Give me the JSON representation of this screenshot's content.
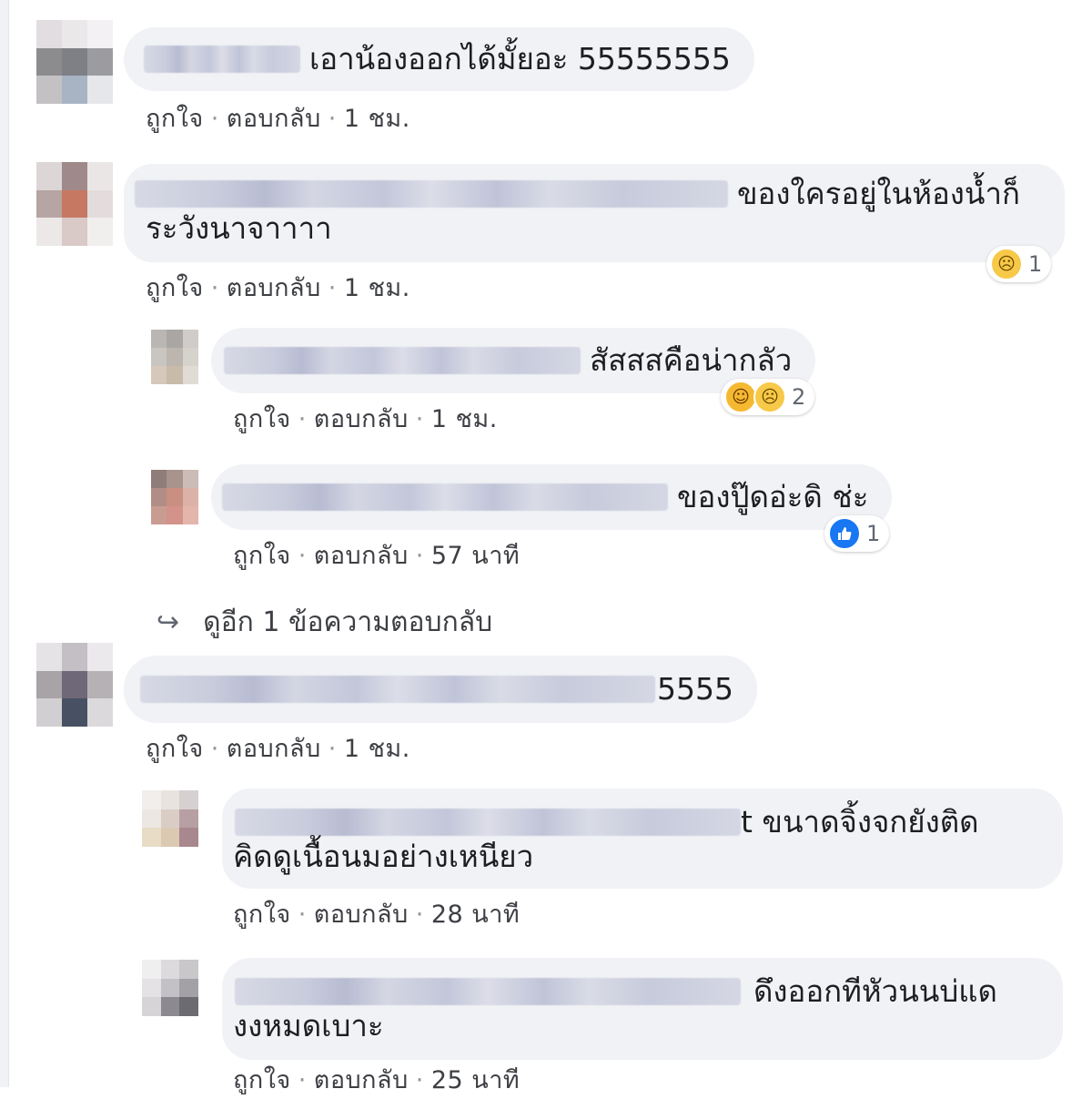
{
  "comments": [
    {
      "text": "เอาน้องออกได้มั้ยอะ 55555555",
      "actions": {
        "like": "ถูกใจ",
        "reply": "ตอบกลับ",
        "time": "1 ชม."
      }
    },
    {
      "text_line1": "ของใครอยู่ในห้องน้ำก็",
      "text_line2": "ระวังนาจาาาา",
      "actions": {
        "like": "ถูกใจ",
        "reply": "ตอบกลับ",
        "time": "1 ชม."
      },
      "reaction": {
        "icons": [
          "sad-emoji"
        ],
        "count": "1"
      },
      "replies": [
        {
          "text": "สัสสสคือน่ากลัว",
          "actions": {
            "like": "ถูกใจ",
            "reply": "ตอบกลับ",
            "time": "1 ชม."
          },
          "reaction": {
            "icons": [
              "haha-emoji",
              "sad-emoji"
            ],
            "count": "2"
          }
        },
        {
          "text": "ของปู๊ดอ่ะดิ ช่ะ",
          "actions": {
            "like": "ถูกใจ",
            "reply": "ตอบกลับ",
            "time": "57 นาที"
          },
          "reaction": {
            "icons": [
              "like-thumb"
            ],
            "count": "1"
          }
        }
      ],
      "more_replies": "ดูอีก 1 ข้อความตอบกลับ"
    },
    {
      "text": "5555",
      "actions": {
        "like": "ถูกใจ",
        "reply": "ตอบกลับ",
        "time": "1 ชม."
      },
      "replies": [
        {
          "text_line1": "t ขนาดจิ้งจกยังติด",
          "text_line2": "คิดดูเนื้อนมอย่างเหนียว",
          "actions": {
            "like": "ถูกใจ",
            "reply": "ตอบกลับ",
            "time": "28 นาที"
          }
        },
        {
          "text_line1": "ดึงออกทีหัวนนบ่แด",
          "text_line2": "งงหมดเบาะ",
          "actions": {
            "like": "ถูกใจ",
            "reply": "ตอบกลับ",
            "time": "25 นาที"
          }
        }
      ]
    }
  ],
  "icons": {
    "sad": "sad-emoji",
    "haha": "haha-emoji",
    "like": "like-thumb",
    "reply_arrow": "reply-arrow-icon"
  },
  "colors": {
    "bubble": "#f0f2f5",
    "like_blue": "#1877f2",
    "emoji_yellow": "#f7c948"
  }
}
